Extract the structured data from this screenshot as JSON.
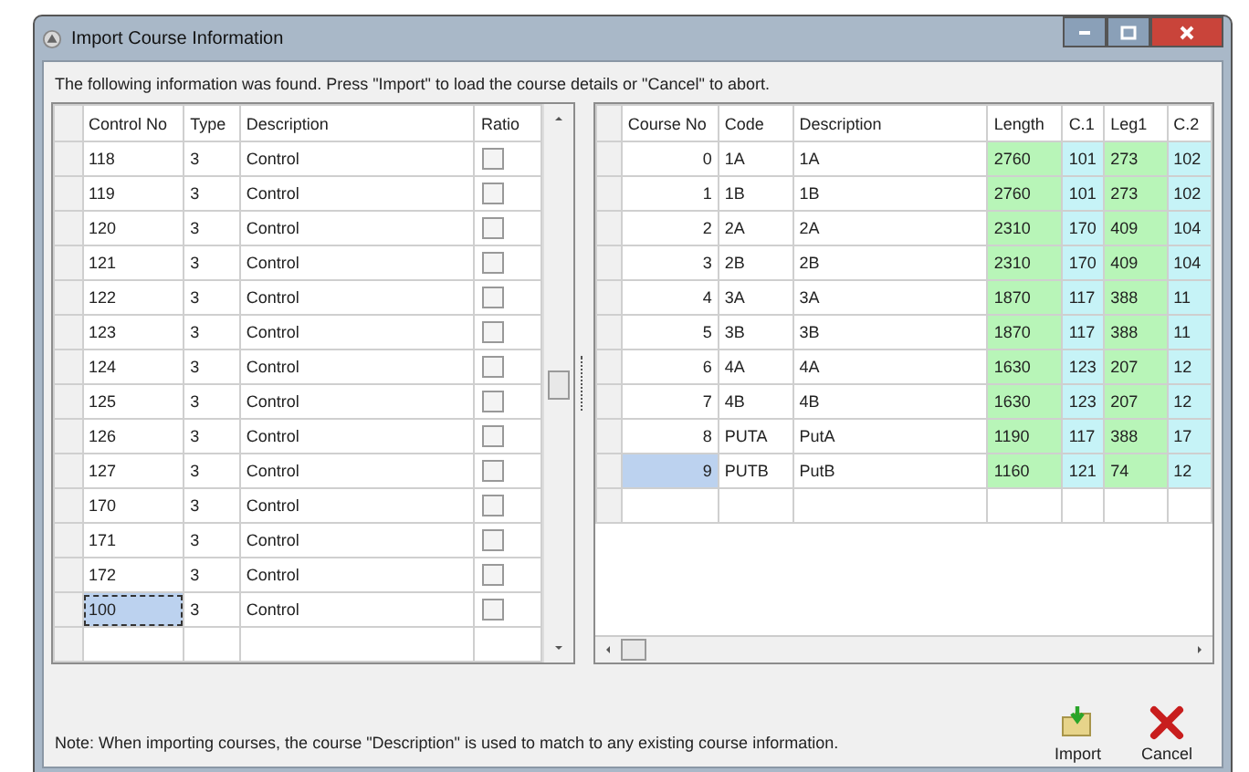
{
  "window": {
    "title": "Import Course Information"
  },
  "message": "The following information was found. Press \"Import\" to load the course details or \"Cancel\" to abort.",
  "controls_table": {
    "columns": [
      "Control No",
      "Type",
      "Description",
      "Ratio"
    ],
    "rows": [
      {
        "cells": [
          "118",
          "3",
          "Control"
        ],
        "ratio_checked": false,
        "selected": false
      },
      {
        "cells": [
          "119",
          "3",
          "Control"
        ],
        "ratio_checked": false,
        "selected": false
      },
      {
        "cells": [
          "120",
          "3",
          "Control"
        ],
        "ratio_checked": false,
        "selected": false
      },
      {
        "cells": [
          "121",
          "3",
          "Control"
        ],
        "ratio_checked": false,
        "selected": false
      },
      {
        "cells": [
          "122",
          "3",
          "Control"
        ],
        "ratio_checked": false,
        "selected": false
      },
      {
        "cells": [
          "123",
          "3",
          "Control"
        ],
        "ratio_checked": false,
        "selected": false
      },
      {
        "cells": [
          "124",
          "3",
          "Control"
        ],
        "ratio_checked": false,
        "selected": false
      },
      {
        "cells": [
          "125",
          "3",
          "Control"
        ],
        "ratio_checked": false,
        "selected": false
      },
      {
        "cells": [
          "126",
          "3",
          "Control"
        ],
        "ratio_checked": false,
        "selected": false
      },
      {
        "cells": [
          "127",
          "3",
          "Control"
        ],
        "ratio_checked": false,
        "selected": false
      },
      {
        "cells": [
          "170",
          "3",
          "Control"
        ],
        "ratio_checked": false,
        "selected": false
      },
      {
        "cells": [
          "171",
          "3",
          "Control"
        ],
        "ratio_checked": false,
        "selected": false
      },
      {
        "cells": [
          "172",
          "3",
          "Control"
        ],
        "ratio_checked": false,
        "selected": false
      },
      {
        "cells": [
          "100",
          "3",
          "Control"
        ],
        "ratio_checked": false,
        "selected": true
      }
    ]
  },
  "courses_table": {
    "columns": [
      {
        "label": "Course No",
        "color": "#ffffff"
      },
      {
        "label": "Code",
        "color": "#ffffff"
      },
      {
        "label": "Description",
        "color": "#ffffff"
      },
      {
        "label": "Length",
        "color": "#b8f5b8"
      },
      {
        "label": "C.1",
        "color": "#c6f3f7"
      },
      {
        "label": "Leg1",
        "color": "#b8f5b8"
      },
      {
        "label": "C.2",
        "color": "#c6f3f7"
      }
    ],
    "rows": [
      {
        "cells": [
          "0",
          "1A",
          "1A",
          "2760",
          "101",
          "273",
          "102"
        ],
        "selected": false
      },
      {
        "cells": [
          "1",
          "1B",
          "1B",
          "2760",
          "101",
          "273",
          "102"
        ],
        "selected": false
      },
      {
        "cells": [
          "2",
          "2A",
          "2A",
          "2310",
          "170",
          "409",
          "104"
        ],
        "selected": false
      },
      {
        "cells": [
          "3",
          "2B",
          "2B",
          "2310",
          "170",
          "409",
          "104"
        ],
        "selected": false
      },
      {
        "cells": [
          "4",
          "3A",
          "3A",
          "1870",
          "117",
          "388",
          "11"
        ],
        "selected": false
      },
      {
        "cells": [
          "5",
          "3B",
          "3B",
          "1870",
          "117",
          "388",
          "11"
        ],
        "selected": false
      },
      {
        "cells": [
          "6",
          "4A",
          "4A",
          "1630",
          "123",
          "207",
          "12"
        ],
        "selected": false
      },
      {
        "cells": [
          "7",
          "4B",
          "4B",
          "1630",
          "123",
          "207",
          "12"
        ],
        "selected": false
      },
      {
        "cells": [
          "8",
          "PUTA",
          "PutA",
          "1190",
          "117",
          "388",
          "17"
        ],
        "selected": false
      },
      {
        "cells": [
          "9",
          "PUTB",
          "PutB",
          "1160",
          "121",
          "74",
          "12"
        ],
        "selected": true
      }
    ]
  },
  "note": "Note: When importing courses, the course \"Description\" is used to match to any existing course information.",
  "buttons": [
    {
      "label": "Import",
      "kind": "import"
    },
    {
      "label": "Cancel",
      "kind": "cancel"
    }
  ]
}
